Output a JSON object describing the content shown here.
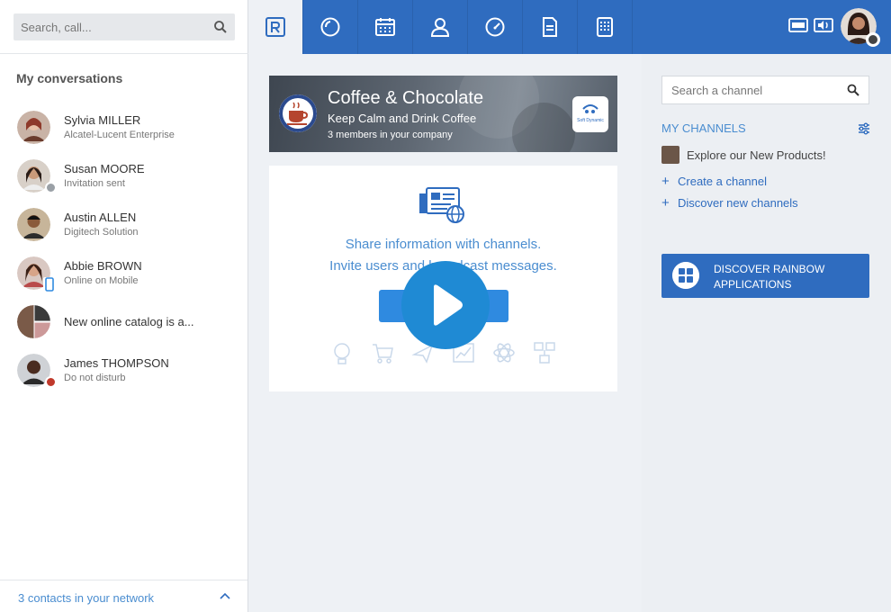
{
  "left_panel": {
    "search_placeholder": "Search, call...",
    "title": "My conversations",
    "conversations": [
      {
        "name": "Sylvia MILLER",
        "subtitle": "Alcatel-Lucent Enterprise",
        "status": "none"
      },
      {
        "name": "Susan MOORE",
        "subtitle": "Invitation sent",
        "status": "pending"
      },
      {
        "name": "Austin ALLEN",
        "subtitle": "Digitech Solution",
        "status": "none"
      },
      {
        "name": "Abbie BROWN",
        "subtitle": "Online on Mobile",
        "status": "mobile"
      },
      {
        "name": "New online catalog is a...",
        "subtitle": "",
        "status": "group"
      },
      {
        "name": "James THOMPSON",
        "subtitle": "Do not disturb",
        "status": "dnd"
      }
    ],
    "footer_text": "3 contacts in your network"
  },
  "topbar": {
    "tabs": [
      {
        "icon": "rainbow-logo-icon",
        "active": true
      },
      {
        "icon": "recent-icon",
        "active": false
      },
      {
        "icon": "calendar-icon",
        "active": false
      },
      {
        "icon": "contacts-icon",
        "active": false
      },
      {
        "icon": "dashboard-icon",
        "active": false
      },
      {
        "icon": "document-icon",
        "active": false
      },
      {
        "icon": "dialpad-icon",
        "active": false
      }
    ],
    "right_icons": [
      "keyboard-icon",
      "audio-settings-icon"
    ]
  },
  "channel_banner": {
    "name": "Coffee & Chocolate",
    "tagline": "Keep Calm and Drink Coffee",
    "members": "3 members in your company",
    "company_logo_text": "Soft Dynamic"
  },
  "info_card": {
    "line1": "Share information with channels.",
    "line2": "Invite users and broadcast messages.",
    "button": "Create"
  },
  "right_panel": {
    "search_placeholder": "Search a channel",
    "my_channels_title": "MY CHANNELS",
    "channels": [
      {
        "name": "Explore our New Products!"
      }
    ],
    "create_channel": "Create a channel",
    "discover_channels": "Discover new channels",
    "discover_button_line1": "DISCOVER RAINBOW",
    "discover_button_line2": "APPLICATIONS"
  },
  "colors": {
    "brand_blue": "#2f6cbf",
    "accent_blue": "#4a8dd0",
    "play_blue": "#1f8ad4"
  }
}
